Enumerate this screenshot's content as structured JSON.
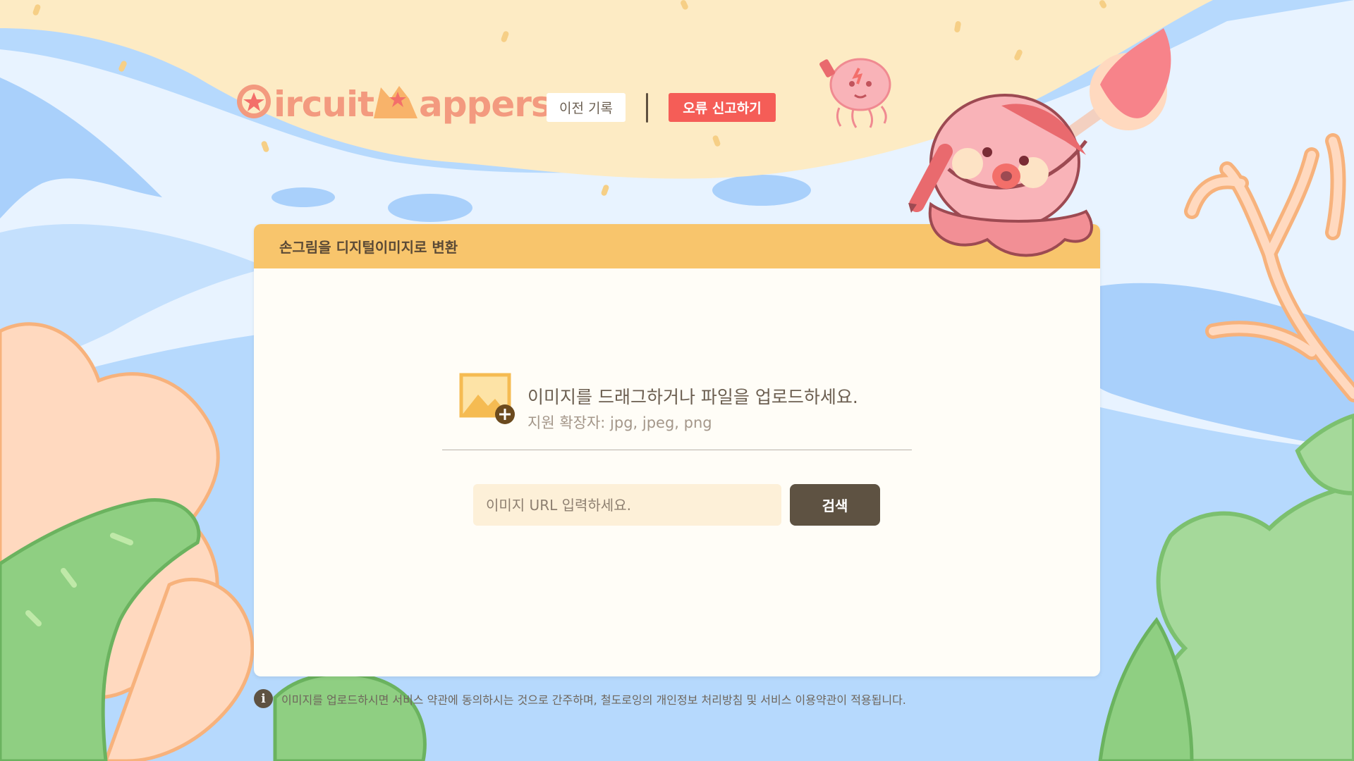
{
  "header": {
    "logo_word_1": "ircuit",
    "logo_word_2": "appers",
    "history_button": "이전 기록",
    "report_button": "오류 신고하기"
  },
  "card": {
    "title": "손그림을 디지털이미지로 변환",
    "upload_title": "이미지를 드래그하거나 파일을 업로드하세요.",
    "upload_subtitle": "지원 확장자: jpg, jpeg, png",
    "url_placeholder": "이미지 URL 입력하세요.",
    "search_button": "검색"
  },
  "notice": {
    "icon": "info-icon",
    "text": "이미지를 업로드하시면 서비스 약관에 동의하시는 것으로 간주하며, 철도로잉의 개인정보 처리방침 및 서비스 이용약관이 적용됩니다."
  },
  "colors": {
    "card_header": "#f8c56c",
    "report_button": "#f55d57",
    "search_button": "#5e5242",
    "logo": "#f39a7f",
    "sand": "#fdebc4",
    "water": "#b9dcff"
  }
}
